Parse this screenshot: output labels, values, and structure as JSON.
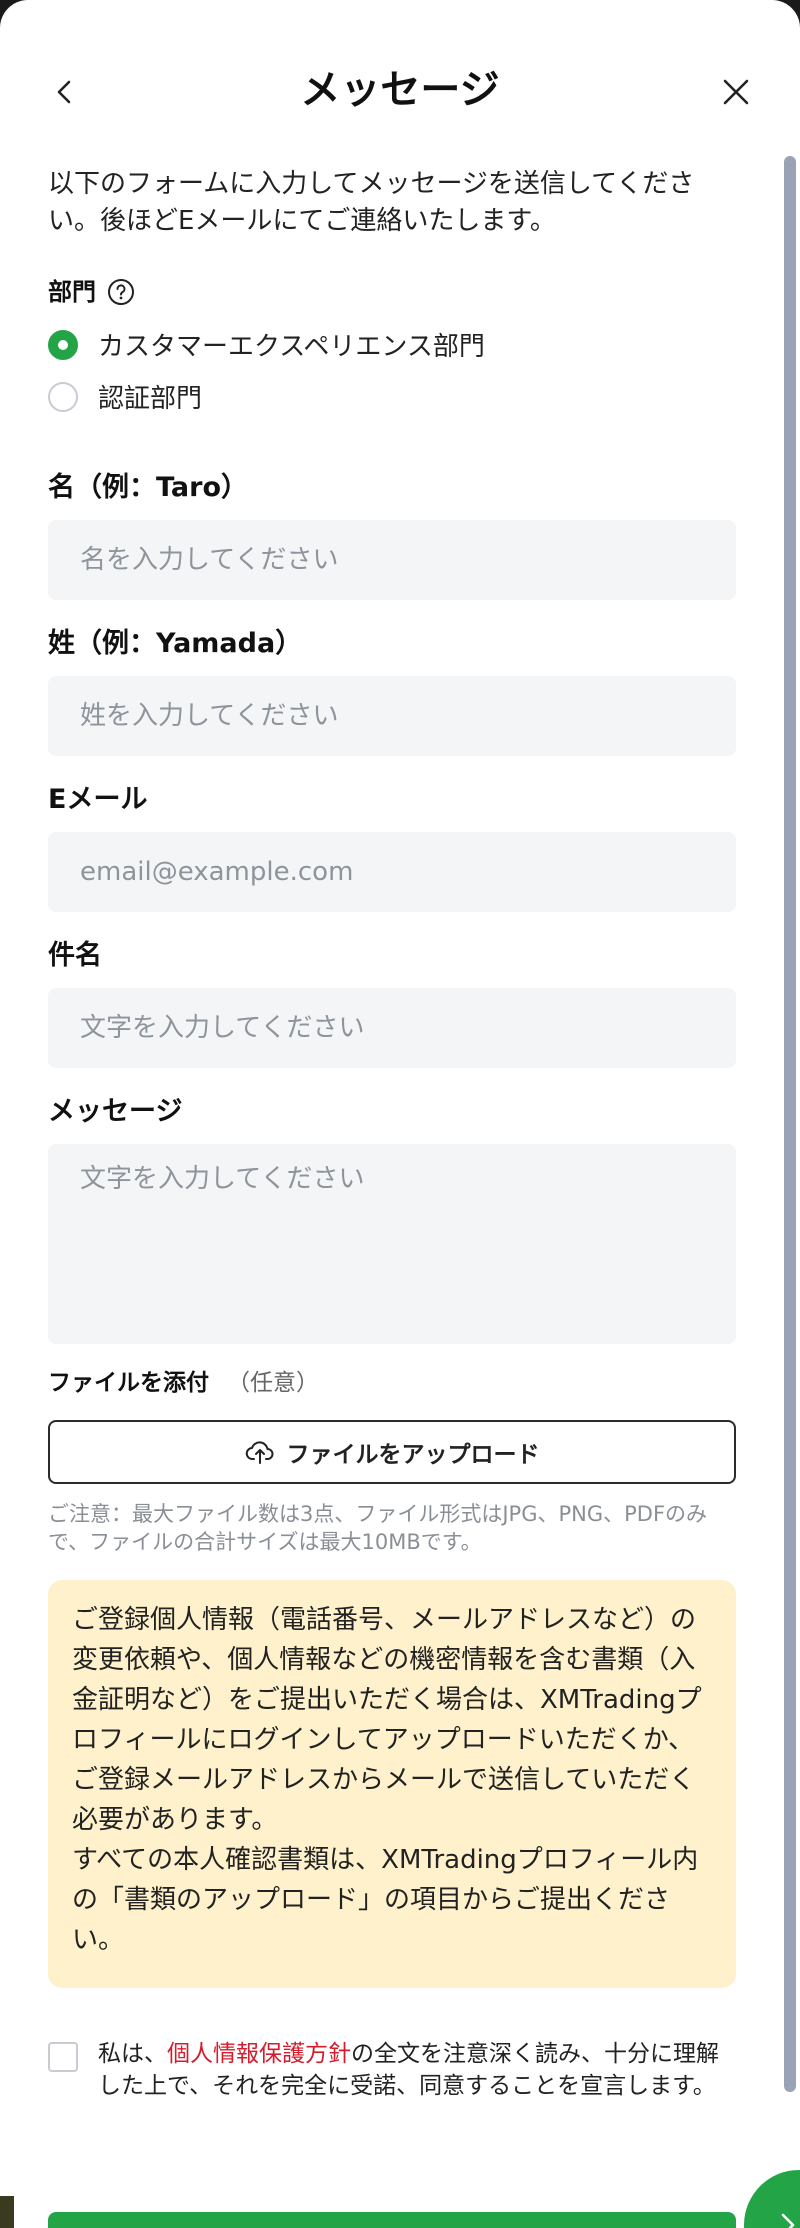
{
  "header": {
    "title": "メッセージ"
  },
  "intro": "以下のフォームに入力してメッセージを送信してください。後ほどEメールにてご連絡いたします。",
  "department": {
    "label": "部門",
    "options": [
      {
        "label": "カスタマーエクスペリエンス部門",
        "selected": true
      },
      {
        "label": "認証部門",
        "selected": false
      }
    ]
  },
  "fields": {
    "first_name": {
      "label": "名（例：Taro）",
      "placeholder": "名を入力してください"
    },
    "last_name": {
      "label": "姓（例：Yamada）",
      "placeholder": "姓を入力してください"
    },
    "email": {
      "label": "Eメール",
      "placeholder": "email@example.com"
    },
    "subject": {
      "label": "件名",
      "placeholder": "文字を入力してください"
    },
    "message": {
      "label": "メッセージ",
      "placeholder": "文字を入力してください"
    }
  },
  "attachment": {
    "label": "ファイルを添付",
    "optional": "（任意）",
    "button": "ファイルをアップロード",
    "note": "ご注意：最大ファイル数は3点、ファイル形式はJPG、PNG、PDFのみで、ファイルの合計サイズは最大10MBです。"
  },
  "notice": {
    "para1": "ご登録個人情報（電話番号、メールアドレスなど）の変更依頼や、個人情報などの機密情報を含む書類（入金証明など）をご提出いただく場合は、XMTradingプロフィールにログインしてアップロードいただくか、ご登録メールアドレスからメールで送信していただく必要があります。",
    "para2": "すべての本人確認書類は、XMTradingプロフィール内の「書類のアップロード」の項目からご提出ください。"
  },
  "consent": {
    "prefix": "私は、",
    "link": "個人情報保護方針",
    "suffix": "の全文を注意深く読み、十分に理解した上で、それを完全に受諾、同意することを宣言します。",
    "checked": false
  },
  "colors": {
    "accent_green": "#22a447",
    "link_red": "#d41c2c",
    "notice_bg": "#fff1cc",
    "input_bg": "#f4f5f7"
  },
  "icons": {
    "back": "chevron-left-icon",
    "close": "close-icon",
    "help": "question-circle-icon",
    "upload": "cloud-upload-icon",
    "fab": "chevron-right-icon"
  }
}
